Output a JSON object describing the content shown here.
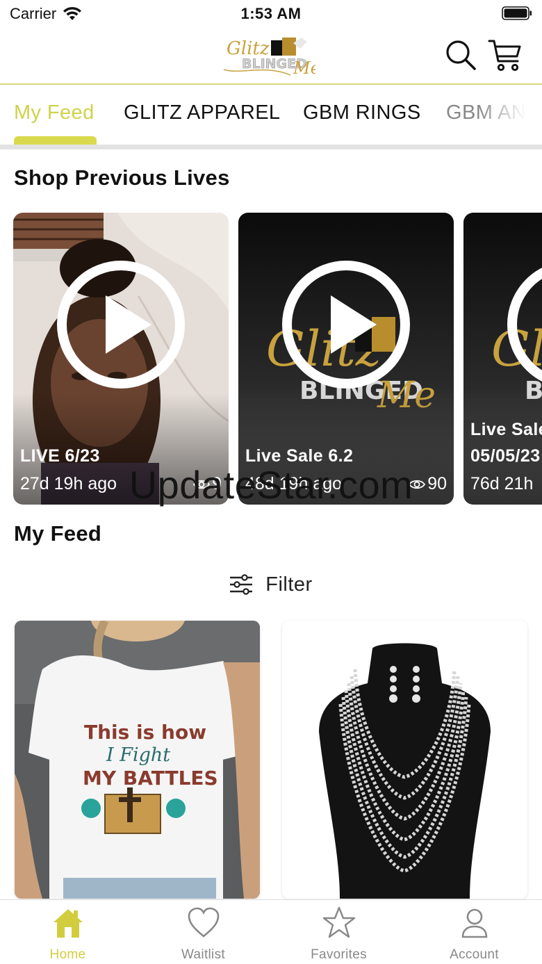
{
  "status_bar": {
    "carrier": "Carrier",
    "time": "1:53 AM"
  },
  "header": {
    "logo_text_top": "Glitz",
    "logo_text_mid": "BLINGED",
    "logo_text_end": "Me"
  },
  "tabs": [
    {
      "label": "My Feed",
      "active": true
    },
    {
      "label": "GLITZ APPAREL",
      "active": false
    },
    {
      "label": "GBM RINGS",
      "active": false
    },
    {
      "label": "GBM AN",
      "active": false
    }
  ],
  "sections": {
    "previous_lives_title": "Shop Previous Lives",
    "feed_title": "My Feed"
  },
  "lives": [
    {
      "title": "LIVE 6/23",
      "time": "27d 19h ago",
      "views": "9"
    },
    {
      "title": "Live Sale 6.2",
      "time": "48d 19h ago",
      "views": "90"
    },
    {
      "title_line1": "Live Sale",
      "title_line2": "05/05/23",
      "time": "76d 21h"
    }
  ],
  "watermark": "UpdateStar.com",
  "filter": {
    "label": "Filter"
  },
  "products": [
    {
      "shirt_line1": "This is how",
      "shirt_line2": "I Fight",
      "shirt_line3": "MY BATTLES"
    },
    {}
  ],
  "bottom_nav": [
    {
      "label": "Home",
      "icon": "home-icon",
      "active": true
    },
    {
      "label": "Waitlist",
      "icon": "heart-icon",
      "active": false
    },
    {
      "label": "Favorites",
      "icon": "star-icon",
      "active": false
    },
    {
      "label": "Account",
      "icon": "person-icon",
      "active": false
    }
  ],
  "colors": {
    "accent": "#d2cd3e",
    "indicator": "#d9d94e",
    "header_rule": "#d9d37a",
    "inactive": "#888888"
  }
}
